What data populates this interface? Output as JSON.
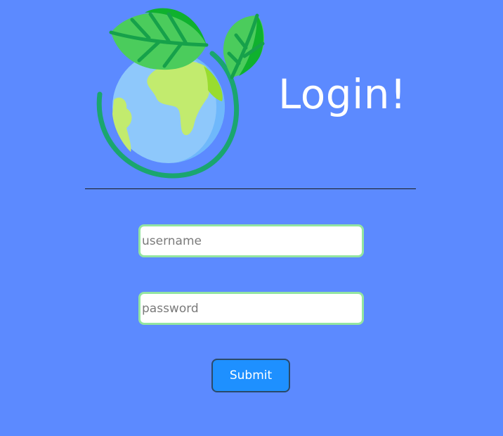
{
  "page": {
    "title": "Login!",
    "background_color": "#5c8aff"
  },
  "logo": {
    "icon": "earth-with-leaves-icon"
  },
  "form": {
    "username_placeholder": "username",
    "password_placeholder": "password",
    "submit_label": "Submit",
    "input_border_color": "#93e5a0",
    "submit_color": "#1e90ff"
  }
}
